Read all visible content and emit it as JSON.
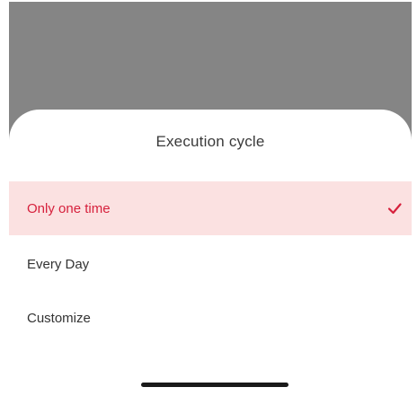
{
  "sheet": {
    "title": "Execution cycle",
    "options": [
      {
        "label": "Only one time",
        "selected": true
      },
      {
        "label": "Every Day",
        "selected": false
      },
      {
        "label": "Customize",
        "selected": false
      }
    ]
  },
  "icons": {
    "selected_check": "check-icon"
  },
  "colors": {
    "accent": "#d6203c",
    "selected_bg": "#fbe1e1",
    "overlay": "#858585"
  }
}
